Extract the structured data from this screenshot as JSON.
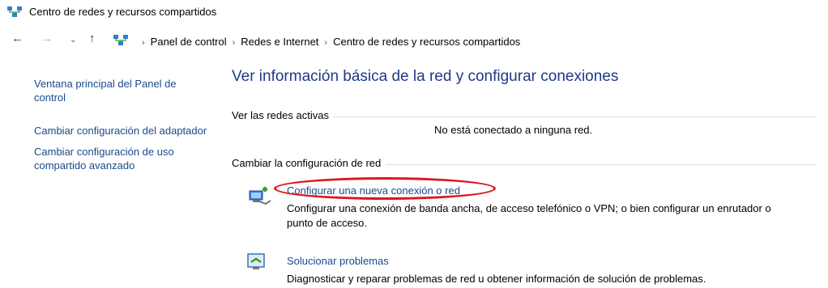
{
  "window": {
    "title": "Centro de redes y recursos compartidos"
  },
  "address_bar": {
    "breadcrumbs": [
      "Panel de control",
      "Redes e Internet",
      "Centro de redes y recursos compartidos"
    ]
  },
  "sidebar": {
    "items": [
      {
        "label": "Ventana principal del Panel de control"
      },
      {
        "label": "Cambiar configuración del adaptador"
      },
      {
        "label": "Cambiar configuración de uso compartido avanzado"
      }
    ]
  },
  "main": {
    "heading": "Ver información básica de la red y configurar conexiones",
    "active_networks": {
      "section_label": "Ver las redes activas",
      "status": "No está conectado a ninguna red."
    },
    "change_settings": {
      "section_label": "Cambiar la configuración de red",
      "tasks": [
        {
          "link": "Configurar una nueva conexión o red",
          "description": "Configurar una conexión de banda ancha, de acceso telefónico o VPN; o bien configurar un enrutador o punto de acceso.",
          "icon": "new-connection-icon"
        },
        {
          "link": "Solucionar problemas",
          "description": "Diagnosticar y reparar problemas de red u obtener información de solución de problemas.",
          "icon": "troubleshoot-icon"
        }
      ]
    }
  },
  "colors": {
    "link": "#1a4a8a",
    "heading": "#1e3a87",
    "highlight": "#e0141e"
  }
}
